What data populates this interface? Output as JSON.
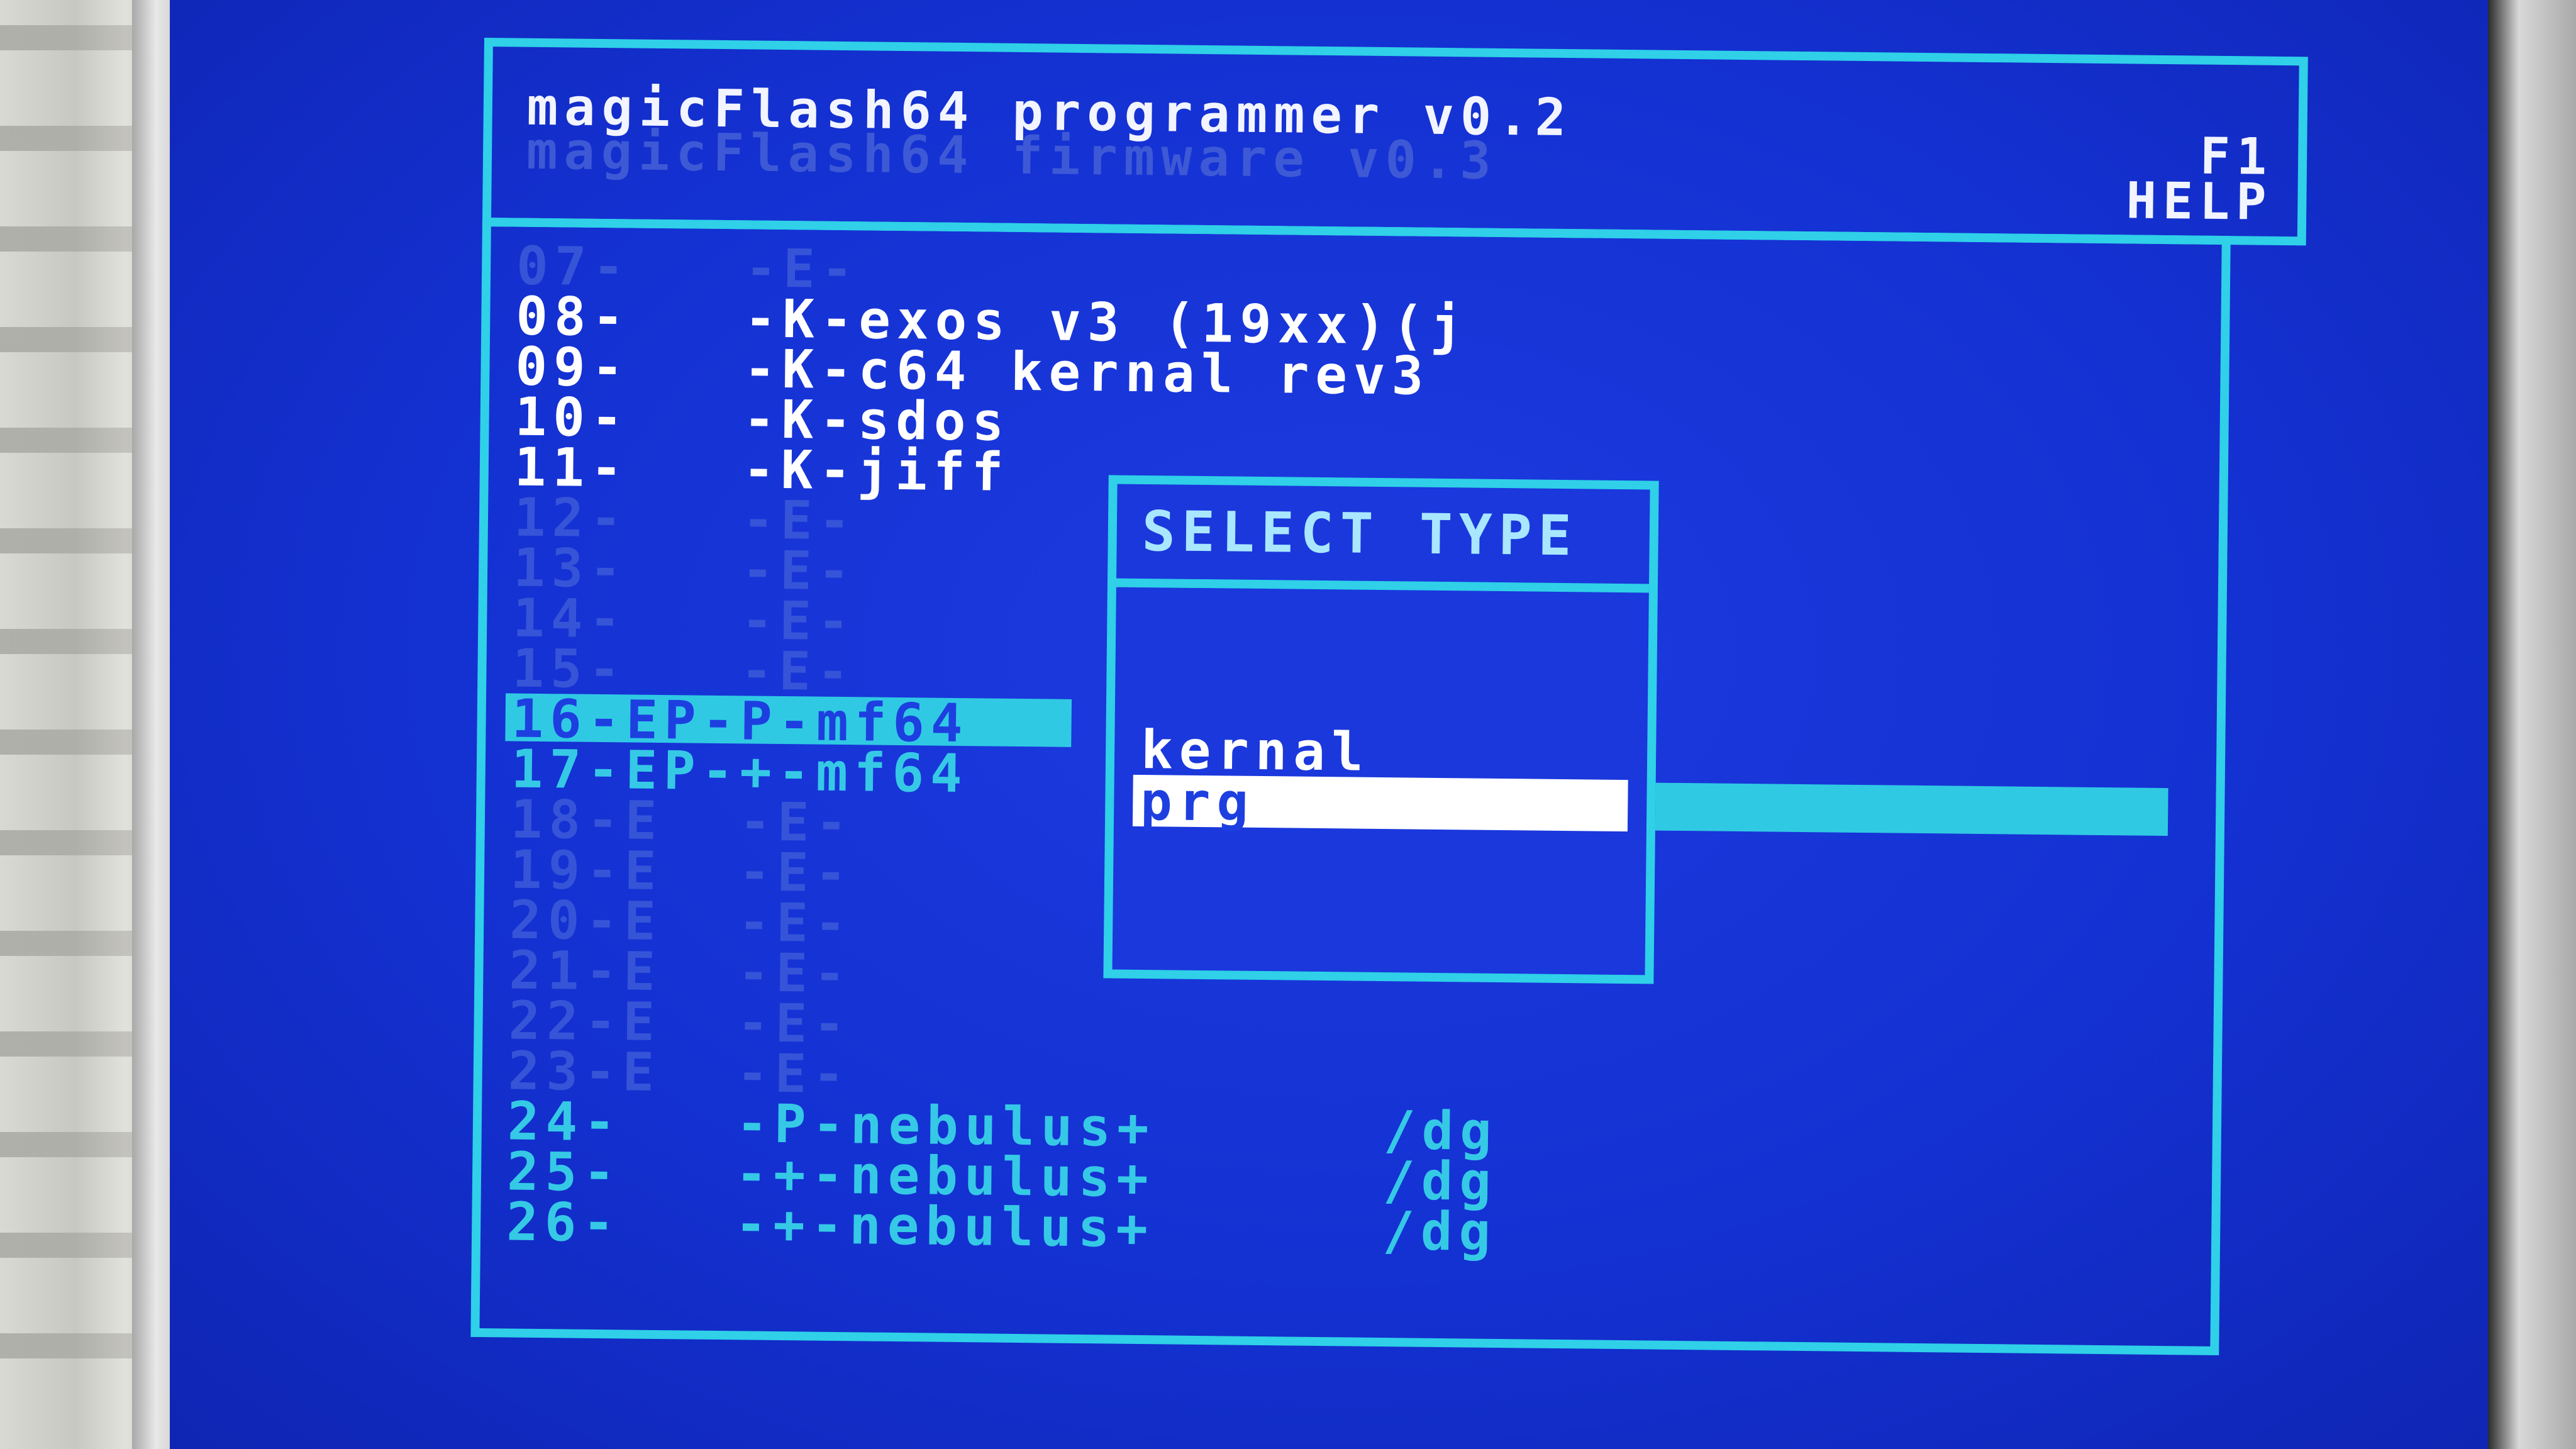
{
  "header": {
    "title": "magicFlash64 programmer v0.2",
    "firmware": "magicFlash64 firmware v0.3",
    "help_key": "F1",
    "help_label": "HELP"
  },
  "slots": [
    {
      "text": "07-   -E-",
      "state": "empty"
    },
    {
      "text": "08-   -K-exos v3 (19xx)(j",
      "state": "active"
    },
    {
      "text": "09-   -K-c64 kernal rev3",
      "state": "active"
    },
    {
      "text": "10-   -K-sdos",
      "state": "active"
    },
    {
      "text": "11-   -K-jiff",
      "state": "active"
    },
    {
      "text": "12-   -E-",
      "state": "empty"
    },
    {
      "text": "13-   -E-",
      "state": "empty"
    },
    {
      "text": "14-   -E-",
      "state": "empty"
    },
    {
      "text": "15-   -E-",
      "state": "empty"
    },
    {
      "text": "16-EP-P-mf64",
      "state": "selected"
    },
    {
      "text": "17-EP-+-mf64",
      "state": "prog"
    },
    {
      "text": "18-E  -E-",
      "state": "empty"
    },
    {
      "text": "19-E  -E-",
      "state": "empty"
    },
    {
      "text": "20-E  -E-",
      "state": "empty"
    },
    {
      "text": "21-E  -E-",
      "state": "empty"
    },
    {
      "text": "22-E  -E-",
      "state": "empty"
    },
    {
      "text": "23-E  -E-",
      "state": "empty"
    },
    {
      "text": "24-   -P-nebulus+      /dg",
      "state": "prog"
    },
    {
      "text": "25-   -+-nebulus+      /dg",
      "state": "prog"
    },
    {
      "text": "26-   -+-nebulus+      /dg",
      "state": "prog"
    }
  ],
  "dialog": {
    "title": "SELECT TYPE",
    "options": [
      "kernal",
      "prg"
    ],
    "selected_index": 1
  },
  "colors": {
    "screen_blue": "#1431d2",
    "border_cyan": "#2fd0e8",
    "text_white": "#f2f4ff",
    "empty_slot_blue": "#3554d8"
  }
}
